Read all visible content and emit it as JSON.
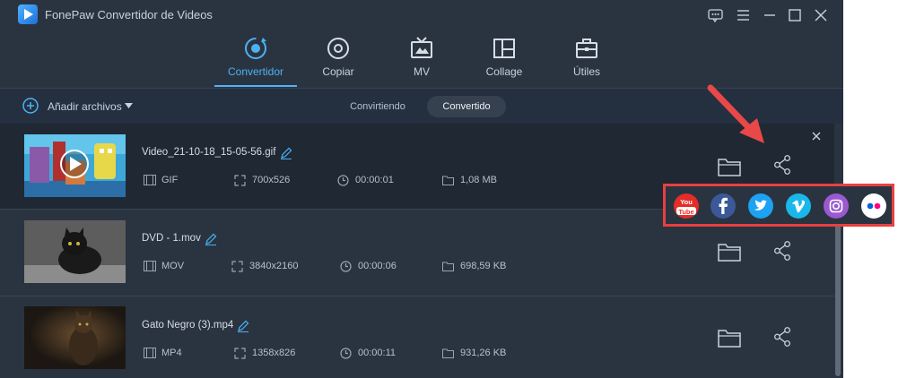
{
  "app": {
    "title": "FonePaw Convertidor de Videos"
  },
  "nav": {
    "items": [
      {
        "label": "Convertidor",
        "icon": "converter-icon",
        "active": true
      },
      {
        "label": "Copiar",
        "icon": "disc-copy-icon",
        "active": false
      },
      {
        "label": "MV",
        "icon": "tv-icon",
        "active": false
      },
      {
        "label": "Collage",
        "icon": "collage-icon",
        "active": false
      },
      {
        "label": "Útiles",
        "icon": "toolbox-icon",
        "active": false
      }
    ]
  },
  "toolbar": {
    "add_files_label": "Añadir archivos",
    "tabs": [
      {
        "label": "Convirtiendo",
        "active": false
      },
      {
        "label": "Convertido",
        "active": true
      }
    ]
  },
  "files": [
    {
      "name": "Video_21-10-18_15-05-56.gif",
      "format": "GIF",
      "resolution": "700x526",
      "duration": "00:00:01",
      "size": "1,08 MB"
    },
    {
      "name": "DVD - 1.mov",
      "format": "MOV",
      "resolution": "3840x2160",
      "duration": "00:00:06",
      "size": "698,59 KB"
    },
    {
      "name": "Gato Negro (3).mp4",
      "format": "MP4",
      "resolution": "1358x826",
      "duration": "00:00:11",
      "size": "931,26 KB"
    }
  ],
  "share_panel": {
    "services": [
      {
        "name": "YouTube",
        "icon": "youtube-icon",
        "color": "#e52d27",
        "text_top": "You",
        "text_bottom": "Tube"
      },
      {
        "name": "Facebook",
        "icon": "facebook-icon",
        "color": "#3b5998"
      },
      {
        "name": "Twitter",
        "icon": "twitter-icon",
        "color": "#1da1f2"
      },
      {
        "name": "Vimeo",
        "icon": "vimeo-icon",
        "color": "#1ab7ea"
      },
      {
        "name": "Instagram",
        "icon": "instagram-icon",
        "color": "#9b59d0"
      },
      {
        "name": "Flickr",
        "icon": "flickr-icon",
        "color": "#ffffff"
      }
    ]
  },
  "colors": {
    "accent": "#4cb2f5",
    "background": "#2a3441",
    "highlight_box": "#e84040"
  }
}
